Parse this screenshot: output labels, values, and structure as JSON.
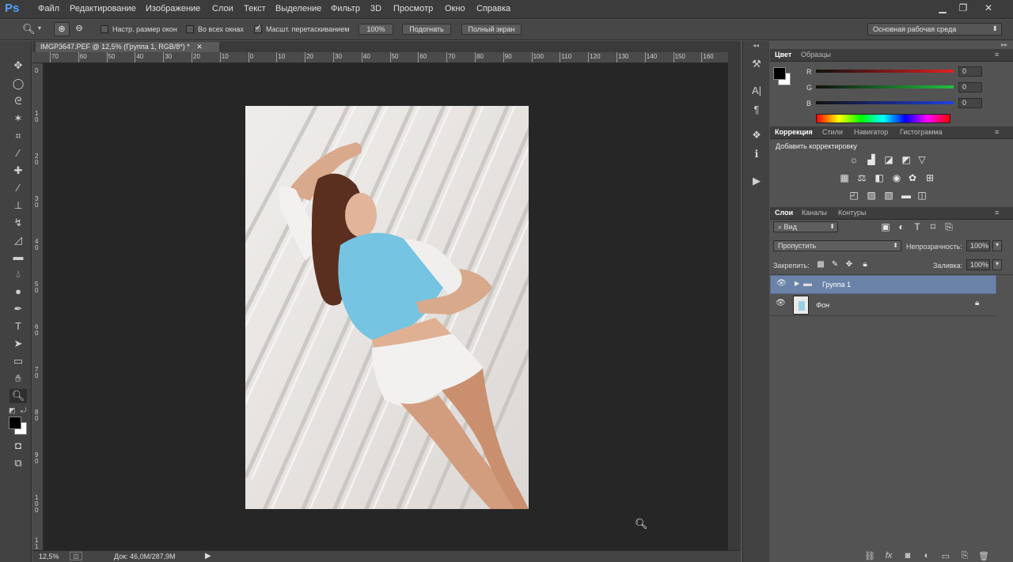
{
  "app": {
    "logo": "Ps"
  },
  "menu": [
    "Файл",
    "Редактирование",
    "Изображение",
    "Слои",
    "Текст",
    "Выделение",
    "Фильтр",
    "3D",
    "Просмотр",
    "Окно",
    "Справка"
  ],
  "options": {
    "resize_windows": "Настр. размер окон",
    "all_windows": "Во всех окнах",
    "scrubby_zoom": "Масшт. перетаскиванием",
    "zoom_value": "100%",
    "fit_button": "Подогнать",
    "fullscreen_button": "Полный экран",
    "workspace": "Основная рабочая среда"
  },
  "document": {
    "tab_title": "IMGP3647.PEF @ 12,5% (Группа 1, RGB/8*) *",
    "zoom": "12,5%",
    "doc_info": "Док: 46,0M/287,9M"
  },
  "ruler": {
    "horizontal": [
      "70",
      "60",
      "50",
      "40",
      "30",
      "20",
      "10",
      "0",
      "10",
      "20",
      "30",
      "40",
      "50",
      "60",
      "70",
      "80",
      "90",
      "100",
      "110",
      "120",
      "130",
      "140",
      "150",
      "160"
    ],
    "vertical": [
      "0",
      "1 0",
      "2 0",
      "3 0",
      "4 0",
      "5 0",
      "6 0",
      "7 0",
      "8 0",
      "9 0",
      "1 0 0",
      "1 1 0"
    ]
  },
  "color_panel": {
    "tabs": [
      "Цвет",
      "Образцы"
    ],
    "channels": [
      {
        "label": "R",
        "value": "0",
        "color": "#e02020"
      },
      {
        "label": "G",
        "value": "0",
        "color": "#22c040"
      },
      {
        "label": "B",
        "value": "0",
        "color": "#2040e0"
      }
    ]
  },
  "adjustments_panel": {
    "tabs": [
      "Коррекция",
      "Стили",
      "Навигатор",
      "Гистограмма"
    ],
    "title": "Добавить корректировку"
  },
  "layers_panel": {
    "tabs": [
      "Слои",
      "Каналы",
      "Контуры"
    ],
    "filter": "Вид",
    "blend_mode": "Пропустить",
    "opacity_label": "Непрозрачность:",
    "opacity_value": "100%",
    "lock_label": "Закрепить:",
    "fill_label": "Заливка:",
    "fill_value": "100%",
    "layers": [
      {
        "name": "Группа 1",
        "type": "group",
        "selected": true
      },
      {
        "name": "Фон",
        "type": "background",
        "locked": true
      }
    ]
  },
  "colors": {
    "accent": "#6b83a8",
    "bg": "#535353",
    "canvas": "#262626"
  }
}
